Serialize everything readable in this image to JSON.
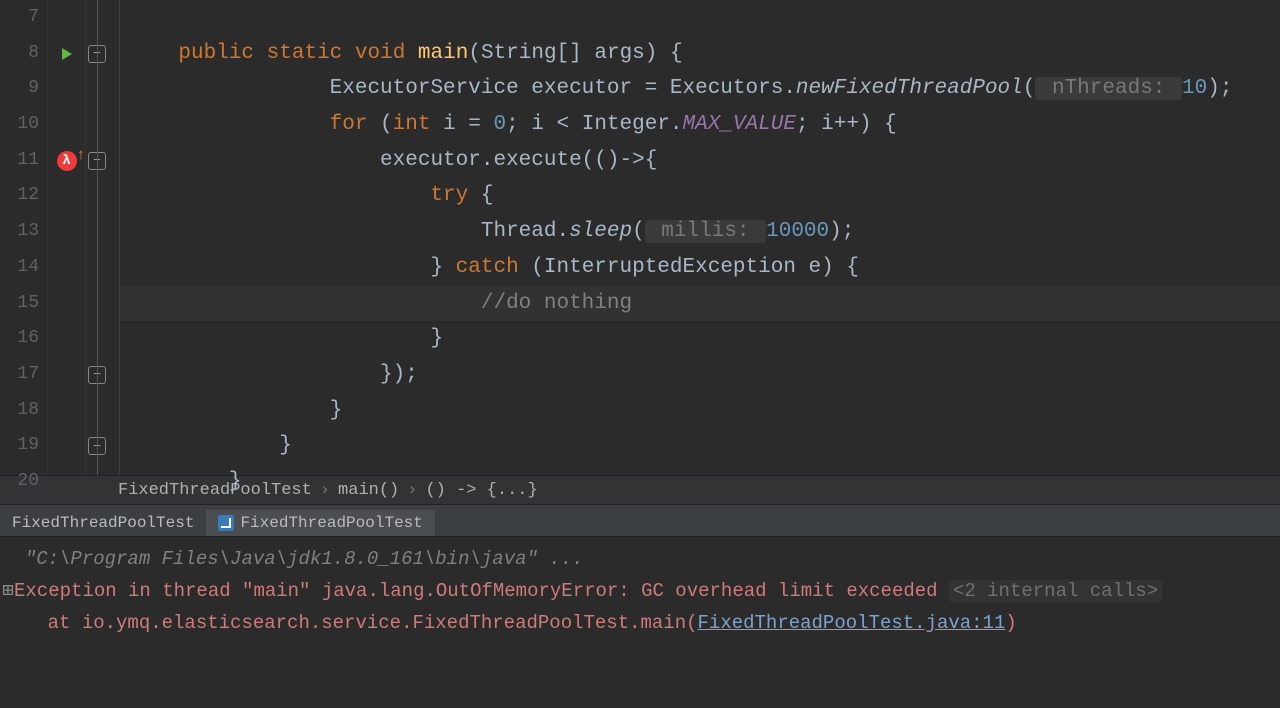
{
  "gutter": {
    "start": 7,
    "end": 20
  },
  "code": {
    "l8": {
      "indent": "    ",
      "kw1": "public",
      "kw2": "static",
      "kw3": "void",
      "fn": "main",
      "rest1": "(String[] args) {"
    },
    "l9": {
      "indent": "                ",
      "t1": "ExecutorService executor = Executors.",
      "ital": "newFixedThreadPool",
      "open": "(",
      "hint": " nThreads: ",
      "num": "10",
      "close": ");"
    },
    "l10": {
      "indent": "                ",
      "kw": "for",
      "t1": " (",
      "kw2": "int",
      "t2": " i = ",
      "num1": "0",
      "t3": "; i < Integer.",
      "const": "MAX_VALUE",
      "t4": "; i++) {"
    },
    "l11": {
      "indent": "                    ",
      "t": "executor.execute(()->{"
    },
    "l12": {
      "indent": "                        ",
      "kw": "try",
      "t": " {"
    },
    "l13": {
      "indent": "                            ",
      "t1": "Thread.",
      "ital": "sleep",
      "open": "(",
      "hint": " millis: ",
      "num": "10000",
      "close": ");"
    },
    "l14": {
      "indent": "                        ",
      "t1": "} ",
      "kw": "catch",
      "t2": " (InterruptedException e) {"
    },
    "l15": {
      "indent": "                            ",
      "cm": "//do nothing"
    },
    "l16": {
      "indent": "                        ",
      "t": "}"
    },
    "l17": {
      "indent": "                    ",
      "t": "});"
    },
    "l18": {
      "indent": "                ",
      "t": "}"
    },
    "l19": {
      "indent": "            ",
      "t": "}"
    },
    "l20": {
      "indent": "        ",
      "t": "}"
    }
  },
  "breadcrumb": {
    "items": [
      "FixedThreadPoolTest",
      "main()",
      "() -> {...}"
    ],
    "sep": "›"
  },
  "tabs": {
    "t1": "FixedThreadPoolTest",
    "t2": "FixedThreadPoolTest"
  },
  "console": {
    "cmd": "\"C:\\Program Files\\Java\\jdk1.8.0_161\\bin\\java\" ...",
    "expander": "⊞",
    "err_main": "Exception in thread \"main\" java.lang.OutOfMemoryError: GC overhead limit exceeded ",
    "err_dim": "<2 internal calls>",
    "at_prefix": "    at io.ymq.elasticsearch.service.FixedThreadPoolTest.main(",
    "link": "FixedThreadPoolTest.java:11",
    "at_suffix": ")"
  }
}
